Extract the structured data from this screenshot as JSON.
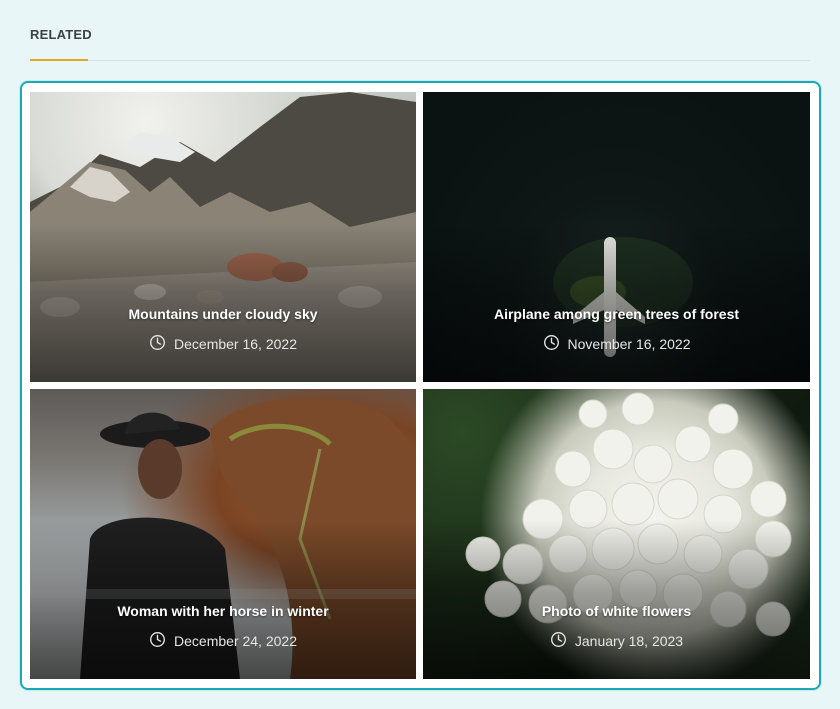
{
  "section": {
    "title": "RELATED"
  },
  "posts": [
    {
      "title": "Mountains under cloudy sky",
      "date": "December 16, 2022",
      "image": "mountains-photo"
    },
    {
      "title": "Airplane among green trees of forest",
      "date": "November 16, 2022",
      "image": "forest-airplane-photo"
    },
    {
      "title": "Woman with her horse in winter",
      "date": "December 24, 2022",
      "image": "woman-horse-photo"
    },
    {
      "title": "Photo of white flowers",
      "date": "January 18, 2023",
      "image": "white-flowers-photo"
    }
  ],
  "icons": {
    "date": "clock-icon"
  },
  "colors": {
    "accent_underline": "#e3a81e",
    "frame_border": "#1aa9b5",
    "background": "#e8f6f7"
  }
}
